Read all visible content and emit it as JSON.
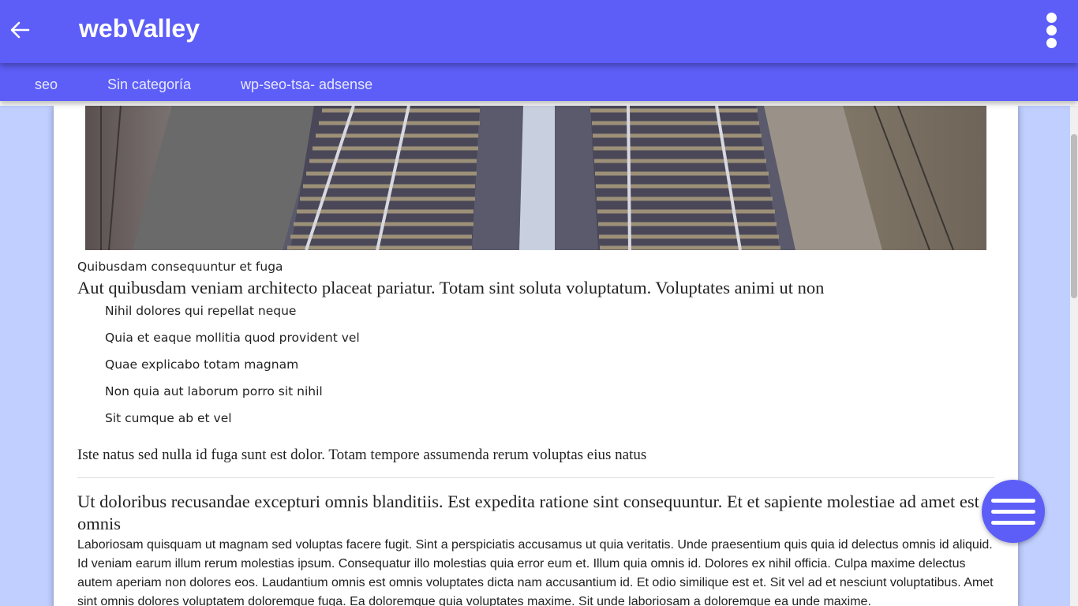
{
  "appbar": {
    "title": "webValley",
    "background": "#5d5ef7",
    "back_icon": "arrow-left-icon",
    "menu_icon": "more-vertical-icon"
  },
  "categories": [
    {
      "label": "seo"
    },
    {
      "label": "Sin categoría"
    },
    {
      "label": "wp-seo-tsa- adsense"
    }
  ],
  "article": {
    "hero_image": "railway-tracks-photo",
    "caption": "Quibusdam consequuntur et fuga",
    "lead": "Aut quibusdam veniam architecto placeat pariatur. Totam sint soluta voluptatum. Voluptates animi ut non",
    "list_items": [
      "Nihil dolores qui repellat neque",
      "Quia et eaque mollitia quod provident vel",
      "Quae explicabo totam magnam",
      "Non quia aut laborum porro sit nihil",
      "Sit cumque ab et vel"
    ],
    "paragraph1": "Iste natus sed nulla id fuga sunt est dolor. Totam tempore assumenda rerum voluptas eius natus",
    "heading2": "Ut doloribus recusandae excepturi omnis blanditiis. Est expedita ratione sint consequuntur. Et et sapiente molestiae ad amet est omnis",
    "body": "Laboriosam quisquam ut magnam sed voluptas facere fugit. Sint a perspiciatis accusamus ut quia veritatis. Unde praesentium quis quia id delectus omnis id aliquid. Id veniam earum illum rerum molestias ipsum. Consequatur illo molestias quia error eum et. Illum quia omnis id. Dolores ex nihil officia. Culpa maxime delectus autem aperiam non dolores eos. Laudantium omnis est omnis voluptates dicta nam accusantium id. Et odio similique est et. Sit vel ad et nesciunt voluptatibus. Amet sint omnis dolores voluptatem doloremque fuga. Ea doloremque quia voluptates maxime. Sit unde laboriosam a doloremque ea unde maxime."
  },
  "fab": {
    "icon": "hamburger-menu-icon"
  }
}
